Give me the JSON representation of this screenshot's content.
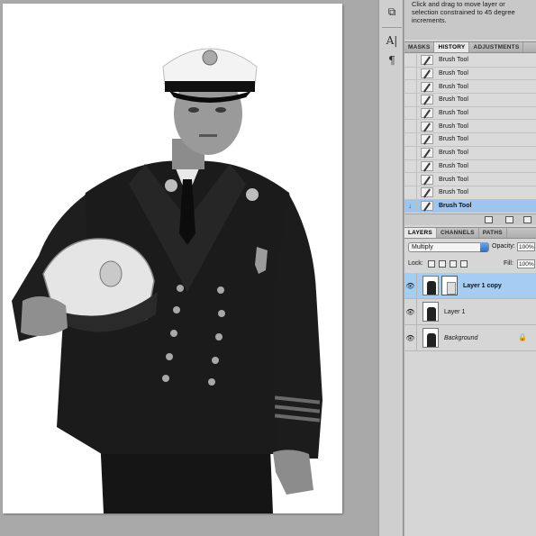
{
  "tool_hint": {
    "text": "Click and drag to move layer or selection constrained to 45 degree increments."
  },
  "history_panel": {
    "tabs": [
      "MASKS",
      "HISTORY",
      "ADJUSTMENTS"
    ],
    "active_tab": "HISTORY",
    "items": [
      {
        "label": "Brush Tool",
        "selected": false
      },
      {
        "label": "Brush Tool",
        "selected": false
      },
      {
        "label": "Brush Tool",
        "selected": false
      },
      {
        "label": "Brush Tool",
        "selected": false
      },
      {
        "label": "Brush Tool",
        "selected": false
      },
      {
        "label": "Brush Tool",
        "selected": false
      },
      {
        "label": "Brush Tool",
        "selected": false
      },
      {
        "label": "Brush Tool",
        "selected": false
      },
      {
        "label": "Brush Tool",
        "selected": false
      },
      {
        "label": "Brush Tool",
        "selected": false
      },
      {
        "label": "Brush Tool",
        "selected": false
      },
      {
        "label": "Brush Tool",
        "selected": true
      }
    ]
  },
  "layers_panel": {
    "tabs": [
      "LAYERS",
      "CHANNELS",
      "PATHS"
    ],
    "active_tab": "LAYERS",
    "blend_mode": "Multiply",
    "opacity_label": "Opacity:",
    "opacity_value": "100%",
    "lock_label": "Lock:",
    "fill_label": "Fill:",
    "fill_value": "100%",
    "layers": [
      {
        "name": "Layer 1 copy",
        "selected": true,
        "has_mask": true,
        "italic": false,
        "locked": false
      },
      {
        "name": "Layer 1",
        "selected": false,
        "has_mask": false,
        "italic": false,
        "locked": false
      },
      {
        "name": "Background",
        "selected": false,
        "has_mask": false,
        "italic": true,
        "locked": true
      }
    ]
  },
  "colors": {
    "canvas_bg": "#a9a9a9",
    "selection_blue": "#a7ccf4",
    "panel_bg": "#d6d6d6"
  }
}
